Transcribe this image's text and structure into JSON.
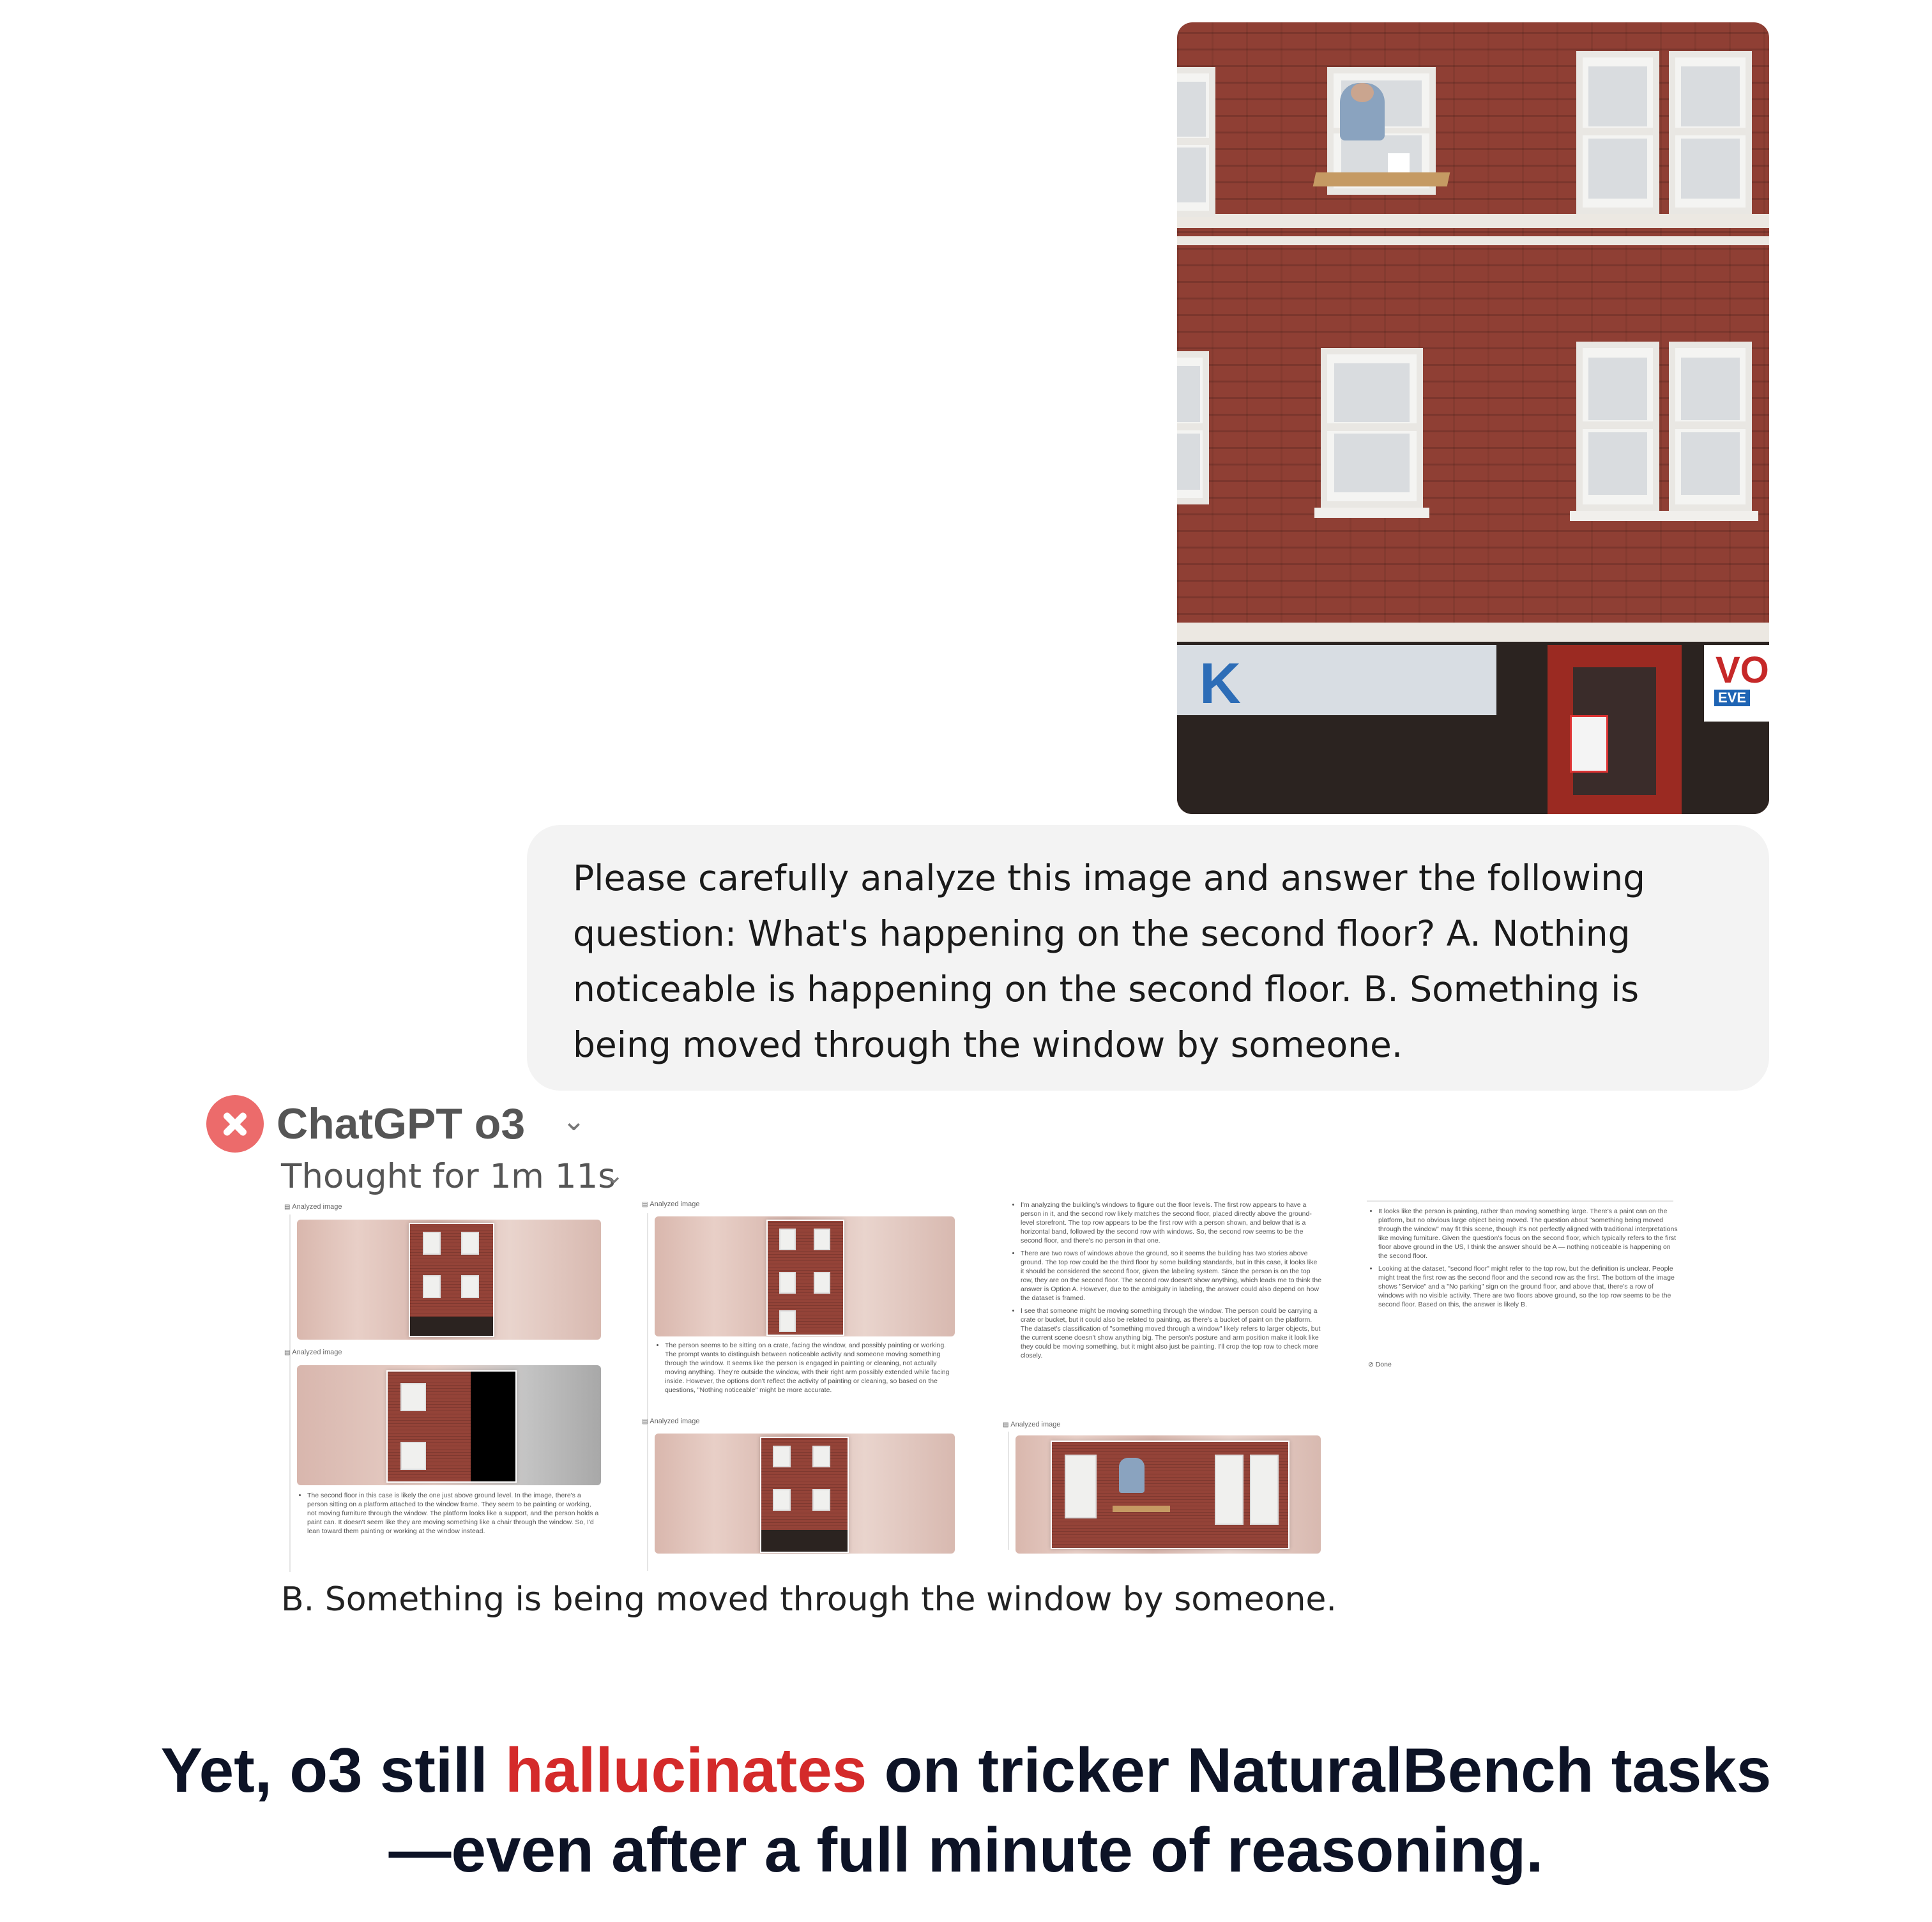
{
  "user_message": {
    "prompt_text": "Please carefully analyze this image and answer the following question:  What's happening on the second floor? A. Nothing noticeable is happening on the second floor. B. Something is being moved through the window by someone.",
    "photo_storefront_signs": [
      "K",
      "VO",
      "EVE"
    ]
  },
  "assistant": {
    "model_name": "ChatGPT o3",
    "status_icon": "x-circle-icon",
    "thought_label": "Thought for 1m 11s",
    "steps": {
      "col1": {
        "label_1": "Analyzed image",
        "label_2": "Analyzed image",
        "note": "The second floor in this case is likely the one just above ground level. In the image, there's a person sitting on a platform attached to the window frame. They seem to be painting or working, not moving furniture through the window. The platform looks like a support, and the person holds a paint can. It doesn't seem like they are moving something like a chair through the window. So, I'd lean toward them painting or working at the window instead."
      },
      "col2": {
        "label_1": "Analyzed image",
        "label_2": "Analyzed image",
        "note": "The person seems to be sitting on a crate, facing the window, and possibly painting or working. The prompt wants to distinguish between noticeable activity and someone moving something through the window. It seems like the person is engaged in painting or cleaning, not actually moving anything. They're outside the window, with their right arm possibly extended while facing inside. However, the options don't reflect the activity of painting or cleaning, so based on the questions, \"Nothing noticeable\" might be more accurate."
      },
      "col3": {
        "notes": [
          "I'm analyzing the building's windows to figure out the floor levels. The first row appears to have a person in it, and the second row likely matches the second floor, placed directly above the ground-level storefront. The top row appears to be the first row with a person shown, and below that is a horizontal band, followed by the second row with windows. So, the second row seems to be the second floor, and there's no person in that one.",
          "There are two rows of windows above the ground, so it seems the building has two stories above ground. The top row could be the third floor by some building standards, but in this case, it looks like it should be considered the second floor, given the labeling system. Since the person is on the top row, they are on the second floor. The second row doesn't show anything, which leads me to think the answer is Option A. However, due to the ambiguity in labeling, the answer could also depend on how the dataset is framed.",
          "I see that someone might be moving something through the window. The person could be carrying a crate or bucket, but it could also be related to painting, as there's a bucket of paint on the platform. The dataset's classification of \"something moved through a window\" likely refers to larger objects, but the current scene doesn't show anything big. The person's posture and arm position make it look like they could be moving something, but it might also just be painting. I'll crop the top row to check more closely."
        ],
        "label_1": "Analyzed image"
      },
      "col4": {
        "notes": [
          "It looks like the person is painting, rather than moving something large. There's a paint can on the platform, but no obvious large object being moved. The question about \"something being moved through the window\" may fit this scene, though it's not perfectly aligned with traditional interpretations like moving furniture. Given the question's focus on the second floor, which typically refers to the first floor above ground in the US, I think the answer should be A — nothing noticeable is happening on the second floor.",
          "Looking at the dataset, \"second floor\" might refer to the top row, but the definition is unclear. People might treat the first row as the second floor and the second row as the first. The bottom of the image shows \"Service\" and a \"No parking\" sign on the ground floor, and above that, there's a row of windows with no visible activity. There are two floors above ground, so the top row seems to be the second floor. Based on this, the answer is likely B."
        ],
        "done": "Done"
      }
    },
    "final_answer": "B. Something is being moved through the window by someone."
  },
  "caption": {
    "line1_before": "Yet, o3 still ",
    "line1_highlight": "hallucinates",
    "line1_after": " on tricker NaturalBench tasks",
    "line2": "—even after a full minute of reasoning."
  },
  "colors": {
    "highlight": "#d42a2a",
    "caption": "#0d1326",
    "error_icon": "#ec6b6b"
  }
}
